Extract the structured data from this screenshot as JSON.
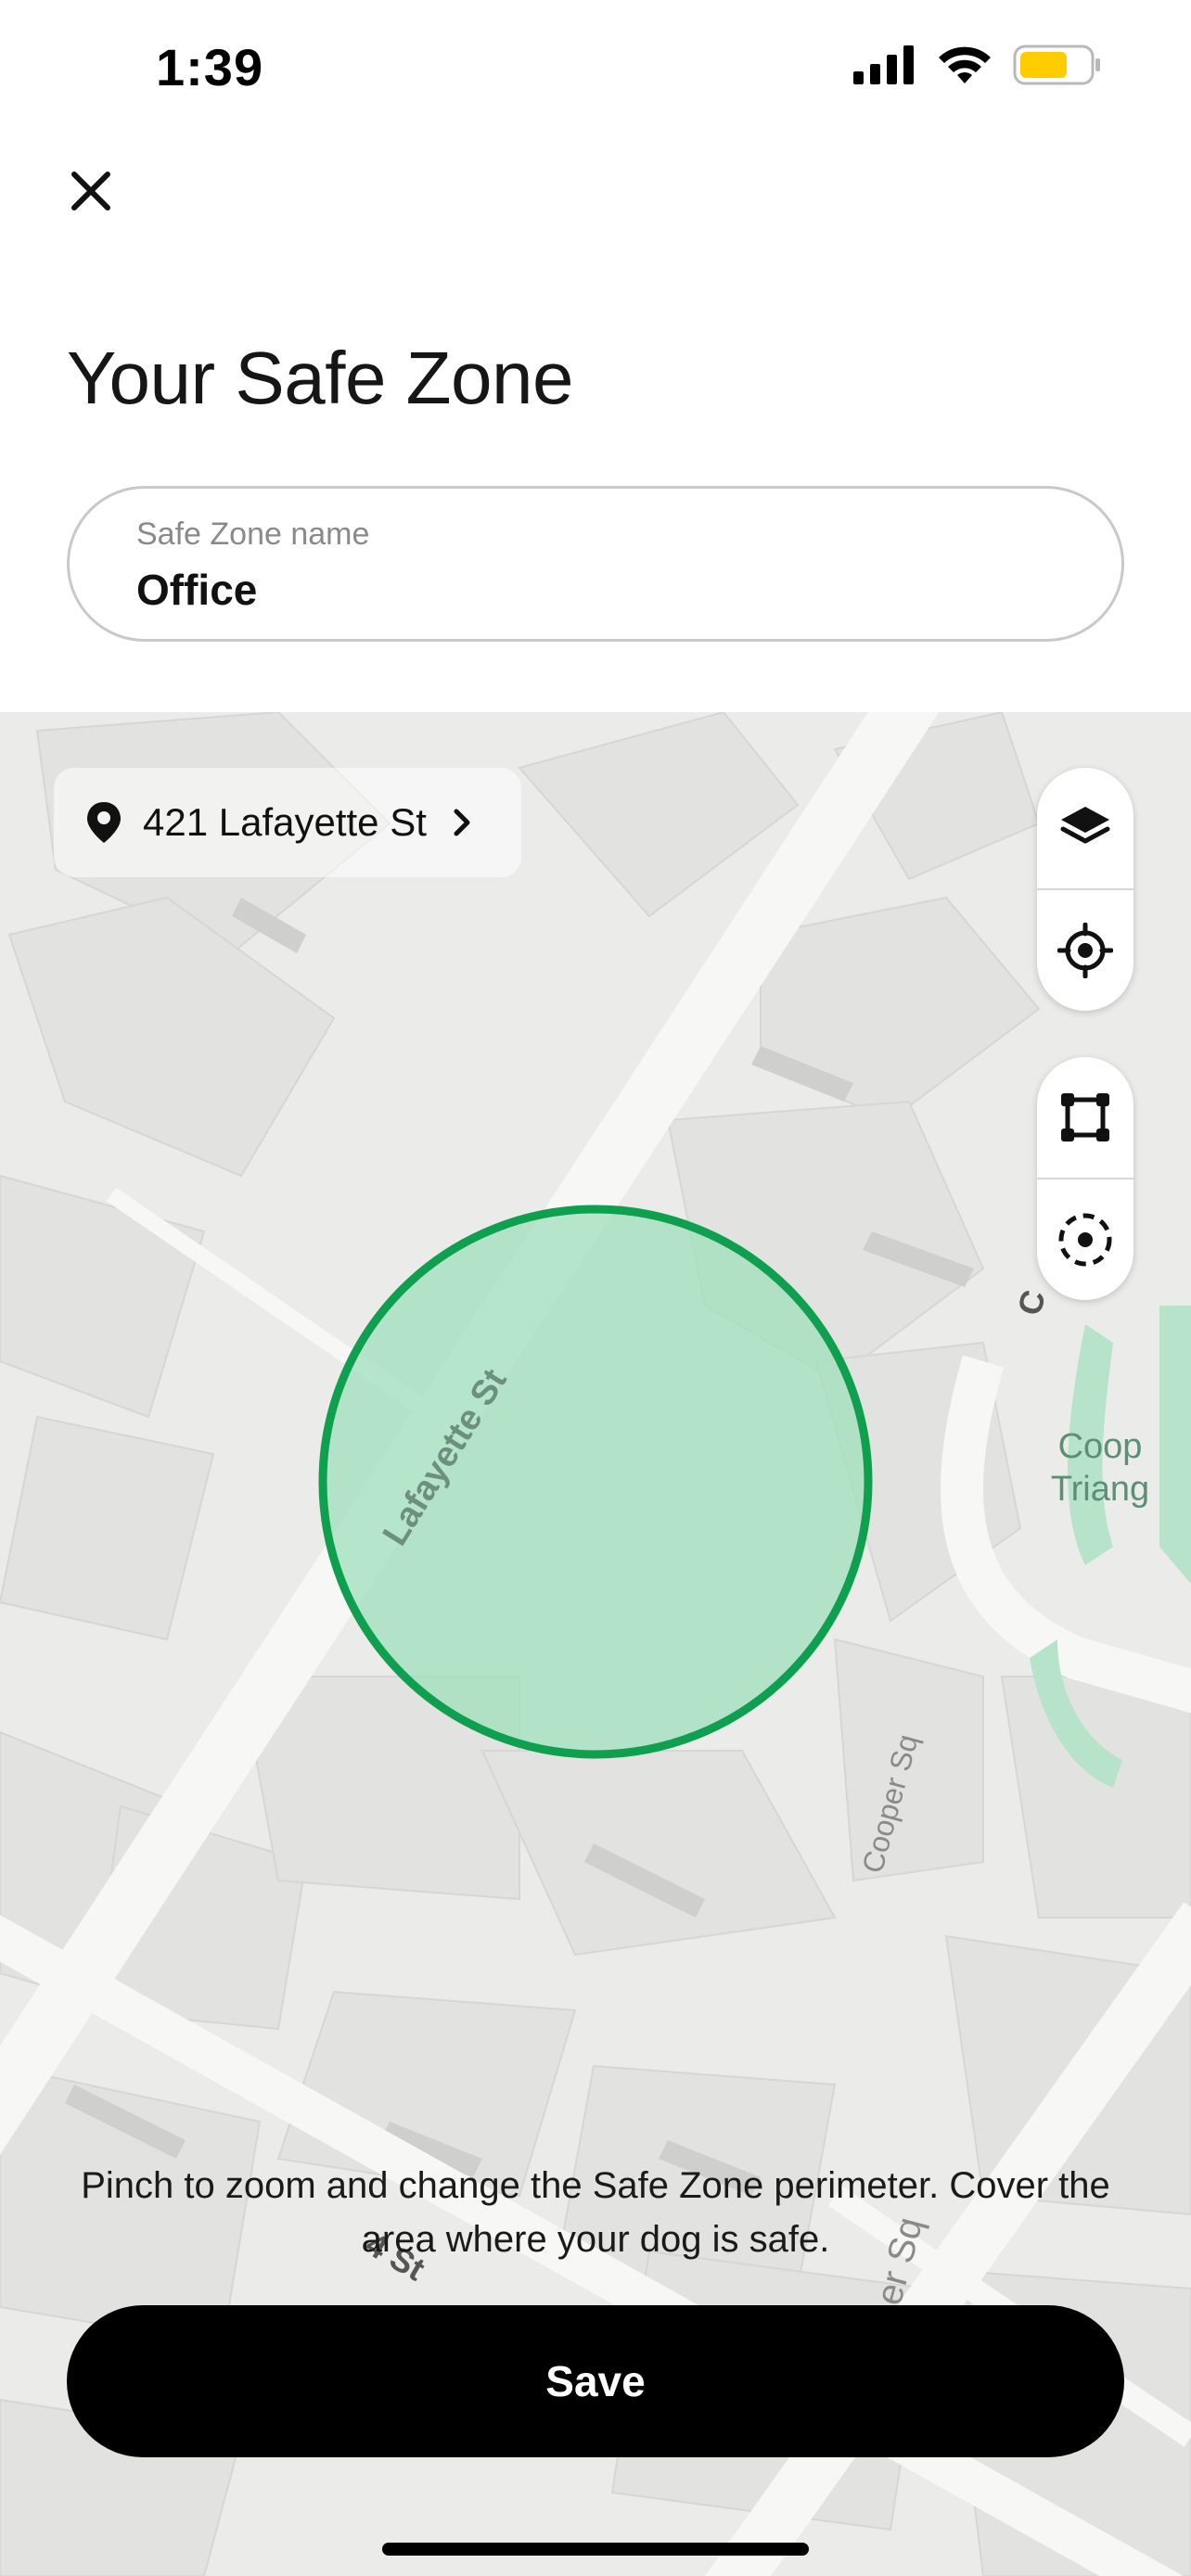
{
  "status_bar": {
    "time": "1:39",
    "battery_color": "#FFCC00"
  },
  "header": {
    "close_icon": "close-icon",
    "title": "Your Safe Zone"
  },
  "zone_name_field": {
    "label": "Safe Zone name",
    "value": "Office"
  },
  "map": {
    "address": "421 Lafayette St",
    "street_labels": [
      "Lafayette St",
      "Cooper Sq",
      "Cooper Sq",
      "Coop",
      "Triang",
      "C",
      "4 St"
    ],
    "zone_color": "#0E9F4F",
    "zone_fill": "#9FE0BC",
    "controls": {
      "layers_icon": "layers-icon",
      "locate_icon": "crosshair-icon",
      "draw_icon": "polygon-draw-icon",
      "center_icon": "target-center-icon"
    }
  },
  "instructions": "Pinch to zoom and change the Safe Zone perimeter. Cover the area where your dog is safe.",
  "save_button": {
    "label": "Save"
  }
}
